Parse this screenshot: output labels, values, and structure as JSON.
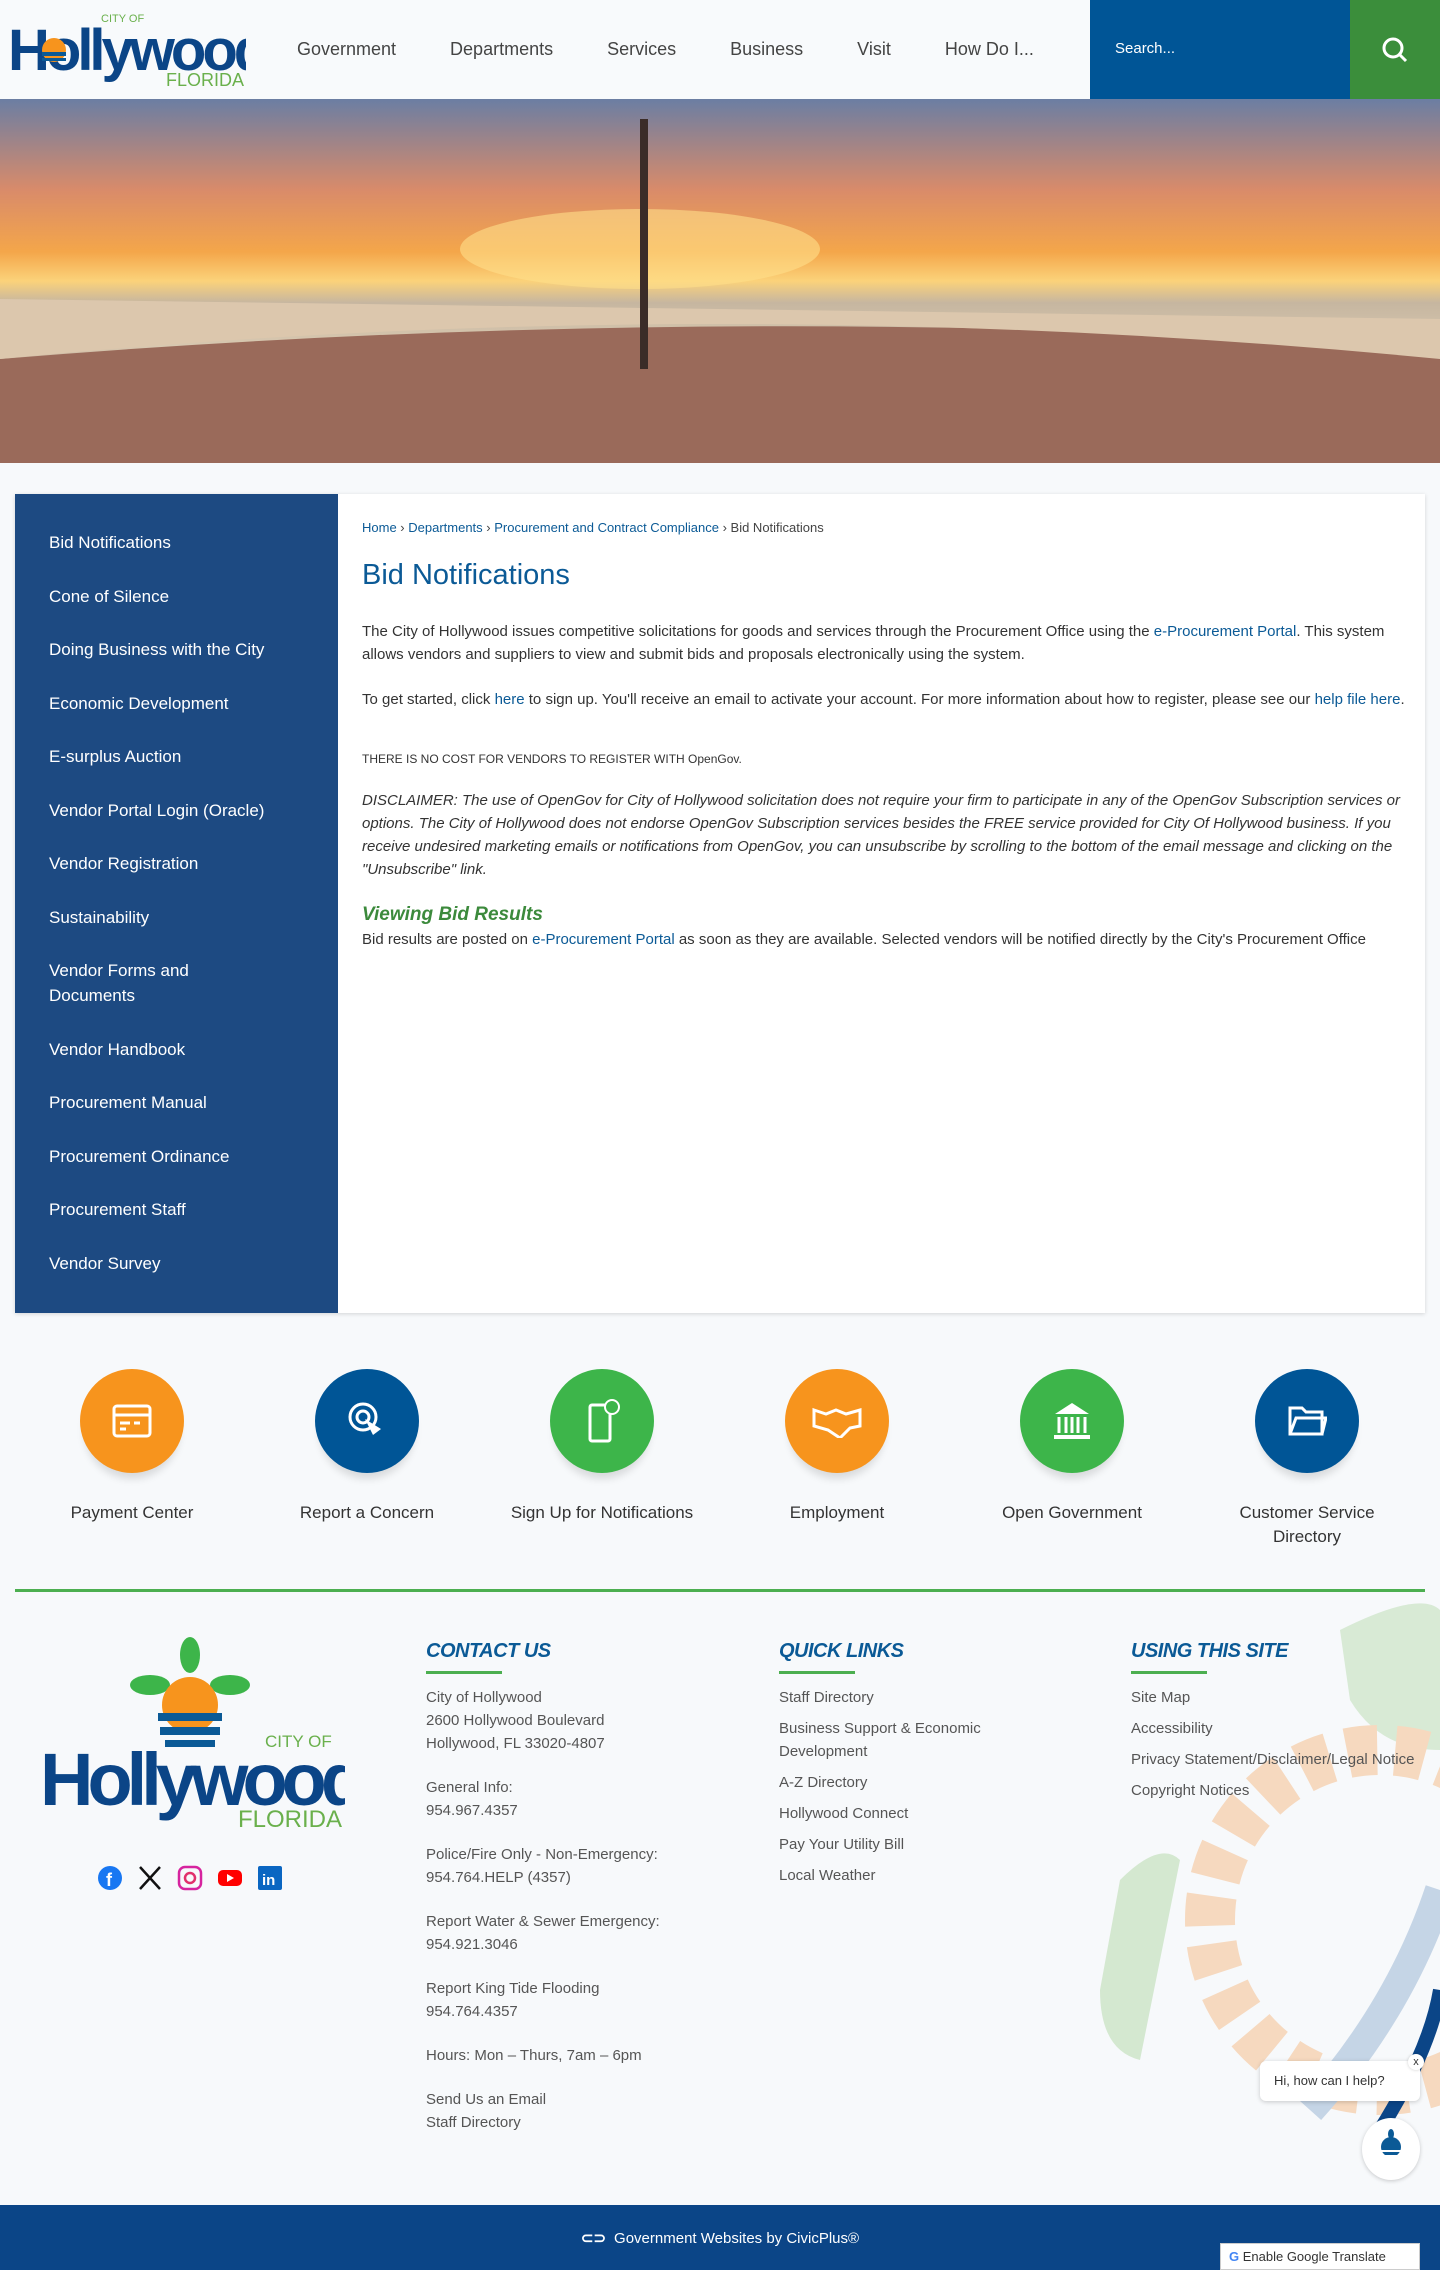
{
  "header": {
    "logo_text": "City of Hollywood Florida",
    "nav": [
      "Government",
      "Departments",
      "Services",
      "Business",
      "Visit",
      "How Do I..."
    ],
    "search_placeholder": "Search..."
  },
  "sidebar": {
    "items": [
      "Bid Notifications",
      "Cone of Silence",
      "Doing Business with the City",
      "Economic Development",
      "E-surplus Auction",
      "Vendor Portal Login (Oracle)",
      "Vendor Registration",
      "Sustainability",
      "Vendor Forms and Documents",
      "Vendor Handbook",
      "Procurement Manual",
      "Procurement Ordinance",
      "Procurement Staff",
      "Vendor Survey"
    ]
  },
  "breadcrumb": {
    "home": "Home",
    "departments": "Departments",
    "section": "Procurement and Contract Compliance",
    "current": "Bid Notifications",
    "sep": " › "
  },
  "main": {
    "title": "Bid Notifications",
    "p1_a": "The City of Hollywood issues competitive solicitations for goods and services through the Procurement Office using the ",
    "p1_link": "e-Procurement Portal",
    "p1_b": ". This system allows vendors and suppliers to view and submit bids and proposals electronically using the system.",
    "p2_a": "To get started, click ",
    "p2_link1": "here",
    "p2_b": " to sign up. You'll receive an email to activate your account. For more information about how to register, please see our ",
    "p2_link2": "help file here",
    "p2_c": ".",
    "notice": "THERE IS NO COST FOR VENDORS TO REGISTER WITH OpenGov.",
    "disclaimer": "DISCLAIMER: The use of  OpenGov for City of Hollywood solicitation does not require your firm to participate in any of the OpenGov Subscription services or options. The City of Hollywood does not endorse OpenGov Subscription services besides the FREE service provided for City Of Hollywood business. If you receive undesired marketing emails or notifications from OpenGov, you can unsubscribe by scrolling to the bottom of the email message and clicking on the \"Unsubscribe\" link.",
    "results_heading": "Viewing Bid Results",
    "results_a": "Bid results are posted on ",
    "results_link": "e-Procurement Portal",
    "results_b": "  as soon as they are available. Selected vendors will be notified directly by the City's Procurement Office"
  },
  "quick_links": [
    {
      "label": "Payment Center",
      "icon": "payment-card-icon",
      "color": "#f7941d"
    },
    {
      "label": "Report a Concern",
      "icon": "touch-icon",
      "color": "#005596"
    },
    {
      "label": "Sign Up for Notifications",
      "icon": "phone-alert-icon",
      "color": "#3db54a"
    },
    {
      "label": "Employment",
      "icon": "handshake-icon",
      "color": "#f7941d"
    },
    {
      "label": "Open Government",
      "icon": "government-building-icon",
      "color": "#3db54a"
    },
    {
      "label": "Customer Service Directory",
      "icon": "folder-icon",
      "color": "#005596"
    }
  ],
  "footer": {
    "contact": {
      "heading": "CONTACT US",
      "items": [
        [
          "City of Hollywood",
          "2600 Hollywood Boulevard",
          "Hollywood, FL 33020-4807"
        ],
        [
          "General Info:",
          "954.967.4357"
        ],
        [
          "Police/Fire Only - Non-Emergency:",
          "954.764.HELP (4357)"
        ],
        [
          "Report Water & Sewer Emergency:",
          "954.921.3046"
        ],
        [
          "Report King Tide Flooding",
          "954.764.4357"
        ],
        [
          "Hours: Mon – Thurs, 7am – 6pm"
        ],
        [
          "Send Us an Email",
          "Staff Directory"
        ]
      ]
    },
    "quick": {
      "heading": "QUICK LINKS",
      "items": [
        "Staff Directory",
        "Business Support & Economic Development",
        "A-Z Directory",
        "Hollywood Connect",
        "Pay Your Utility Bill",
        "Local Weather"
      ]
    },
    "using": {
      "heading": "USING THIS SITE",
      "items": [
        "Site Map",
        "Accessibility",
        "Privacy Statement/Disclaimer/Legal Notice",
        "Copyright Notices"
      ]
    },
    "social": [
      "facebook-icon",
      "x-icon",
      "instagram-icon",
      "youtube-icon",
      "linkedin-icon"
    ],
    "civicplus": "Government Websites by CivicPlus®",
    "translate": "Enable Google Translate",
    "chat": "Hi, how can I help?",
    "chat_close": "x"
  },
  "colors": {
    "blue": "#005596",
    "green": "#3db54a",
    "orange": "#f7941d",
    "sidebar": "#1d4a82"
  }
}
